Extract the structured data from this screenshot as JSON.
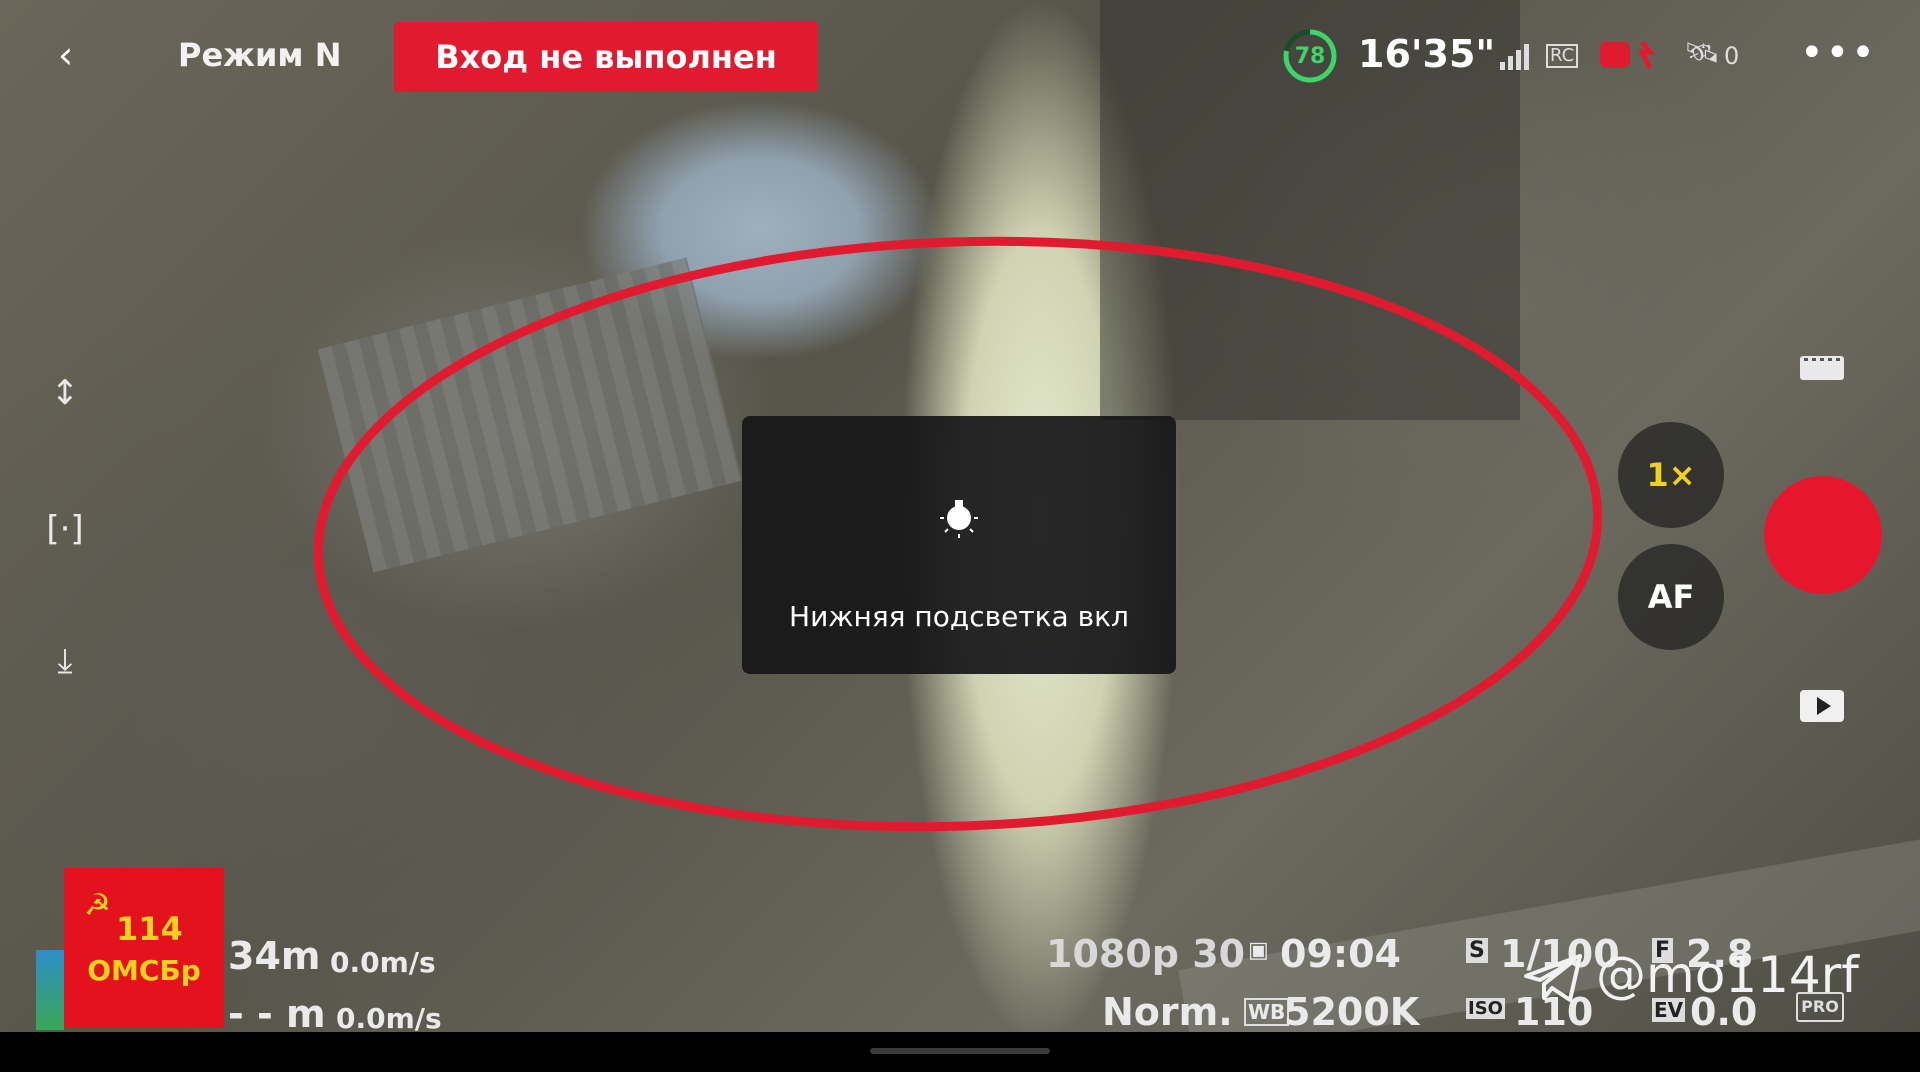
{
  "header": {
    "back_icon": "chevron-left-icon",
    "mode_label": "Режим N",
    "warning_label": "Вход не выполнен",
    "battery_percent": "78",
    "flight_time": "16'35\"",
    "rc_label": "RC",
    "satellite_count": "0",
    "more_icon": "ellipsis-icon",
    "colors": {
      "warning": "#e11b2f",
      "battery": "#3fd36a"
    }
  },
  "toast": {
    "icon": "bulb-icon",
    "message": "Нижняя подсветка вкл"
  },
  "controls": {
    "zoom_label": "1×",
    "af_label": "AF",
    "record_color": "#e8162d"
  },
  "telemetry": {
    "altitude": "34m",
    "vertical_speed": "0.0m/s",
    "distance": "- - m",
    "horizontal_speed": "0.0m/s",
    "resolution": "1080p 30",
    "remaining_time": "09:04",
    "profile": "Norm.",
    "white_balance": "5200K",
    "shutter": "1/100",
    "iso": "110",
    "aperture": "2.8",
    "ev": "0.0",
    "pro_label": "PRO"
  },
  "watermark": {
    "logo_number": "114",
    "logo_name": "ОМСБр",
    "channel": "@mo114rf",
    "logo_color": "#e3121c"
  }
}
